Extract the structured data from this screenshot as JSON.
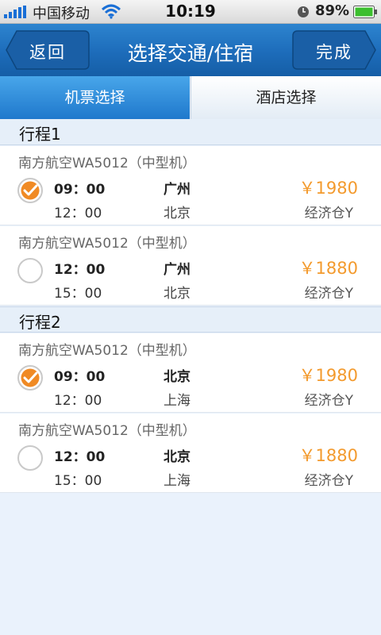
{
  "status_bar": {
    "carrier": "中国移动",
    "time": "10:19",
    "battery": "89%",
    "signal_icon": "signal-bars-icon",
    "wifi_icon": "wifi-icon",
    "alarm_icon": "alarm-clock-icon",
    "battery_icon": "battery-icon"
  },
  "nav": {
    "back_label": "返回",
    "title": "选择交通/住宿",
    "done_label": "完成"
  },
  "tabs": [
    {
      "label": "机票选择",
      "active": true
    },
    {
      "label": "酒店选择",
      "active": false
    }
  ],
  "itineraries": [
    {
      "title": "行程1",
      "flights": [
        {
          "airline": "南方航空WA5012（中型机）",
          "dep_time": "09：00",
          "arr_time": "12：00",
          "from": "广州",
          "to": "北京",
          "price": "￥1980",
          "cabin": "经济仓Y",
          "selected": true
        },
        {
          "airline": "南方航空WA5012（中型机）",
          "dep_time": "12：00",
          "arr_time": "15：00",
          "from": "广州",
          "to": "北京",
          "price": "￥1880",
          "cabin": "经济仓Y",
          "selected": false
        }
      ]
    },
    {
      "title": "行程2",
      "flights": [
        {
          "airline": "南方航空WA5012（中型机）",
          "dep_time": "09：00",
          "arr_time": "12：00",
          "from": "北京",
          "to": "上海",
          "price": "￥1980",
          "cabin": "经济仓Y",
          "selected": true
        },
        {
          "airline": "南方航空WA5012（中型机）",
          "dep_time": "12：00",
          "arr_time": "15：00",
          "from": "北京",
          "to": "上海",
          "price": "￥1880",
          "cabin": "经济仓Y",
          "selected": false
        }
      ]
    }
  ],
  "colors": {
    "nav_blue": "#1d6cba",
    "tab_active": "#2f8fdc",
    "price_orange": "#f39a2d",
    "check_orange": "#f08a24"
  }
}
